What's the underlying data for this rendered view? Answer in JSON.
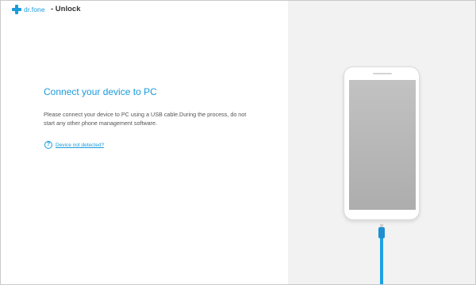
{
  "titlebar": {
    "brand_name": "dr.fone",
    "module_title": "- Unlock",
    "icons": {
      "cart": "cart-icon",
      "user": "user-icon",
      "minimize": "minimize-icon",
      "close": "close-icon"
    }
  },
  "main": {
    "heading": "Connect your device to PC",
    "description": "Please connect your device to PC using a USB cable.During the process, do not start any other phone management software.",
    "help_link": "Device not detected?",
    "help_icon_glyph": "?"
  },
  "colors": {
    "accent": "#1a9bdc",
    "cart": "#f08a24",
    "right_pane_bg": "#f2f2f2",
    "cable": "#1ea1e5"
  }
}
